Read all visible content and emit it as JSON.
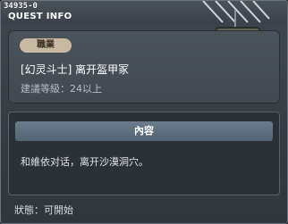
{
  "window": {
    "quest_id": "34935-0",
    "title": "QUEST INFO"
  },
  "job_panel": {
    "badge_label": "職業",
    "job_line": "[幻灵斗士] 离开盔甲冢",
    "level_line": "建議等級：24以上"
  },
  "content_panel": {
    "header_label": "內容",
    "text": "和維依对话，离开沙漠洞穴。"
  },
  "status_line": "狀態：可開始",
  "npc": {
    "icon": "armored-robot-npc-icon"
  }
}
